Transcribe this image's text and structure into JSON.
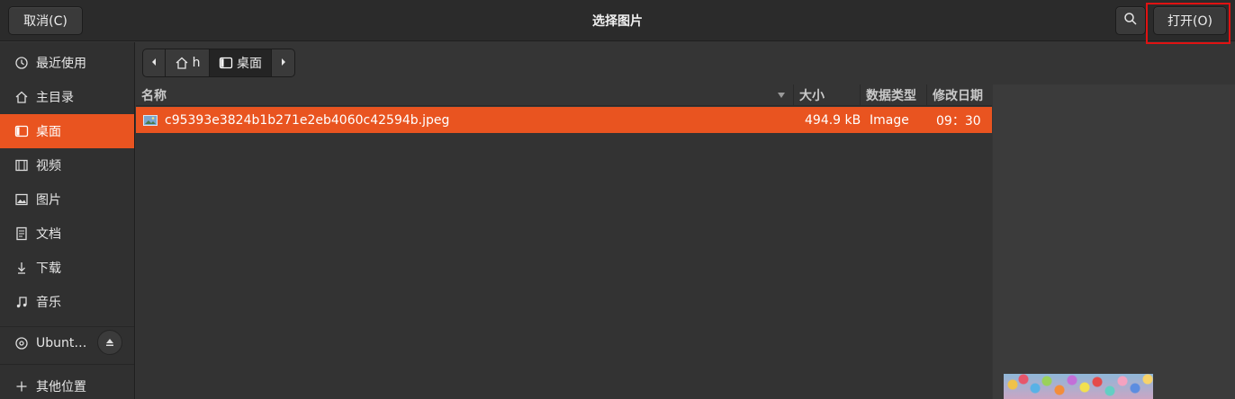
{
  "header": {
    "cancel_label": "取消(C)",
    "title": "选择图片",
    "open_label": "打开(O)"
  },
  "sidebar": {
    "items": [
      {
        "label": "最近使用",
        "icon": "clock-icon"
      },
      {
        "label": "主目录",
        "icon": "home-icon"
      },
      {
        "label": "桌面",
        "icon": "desktop-icon",
        "active": true
      },
      {
        "label": "视频",
        "icon": "film-icon"
      },
      {
        "label": "图片",
        "icon": "image-icon"
      },
      {
        "label": "文档",
        "icon": "document-icon"
      },
      {
        "label": "下载",
        "icon": "download-icon"
      },
      {
        "label": "音乐",
        "icon": "music-icon"
      }
    ],
    "volume": {
      "label": "Ubunt…",
      "icon": "disc-icon"
    },
    "other": {
      "label": "其他位置",
      "icon": "plus-icon"
    }
  },
  "pathbar": {
    "home_label": "h",
    "current_label": "桌面"
  },
  "columns": {
    "name": "名称",
    "size": "大小",
    "type": "数据类型",
    "modified": "修改日期"
  },
  "files": [
    {
      "name": "c95393e3824b1b271e2eb4060c42594b.jpeg",
      "size": "494.9 kB",
      "type": "Image",
      "modified": "09：30",
      "selected": true
    }
  ],
  "colors": {
    "accent": "#e95420",
    "highlight_box": "#e01212"
  }
}
